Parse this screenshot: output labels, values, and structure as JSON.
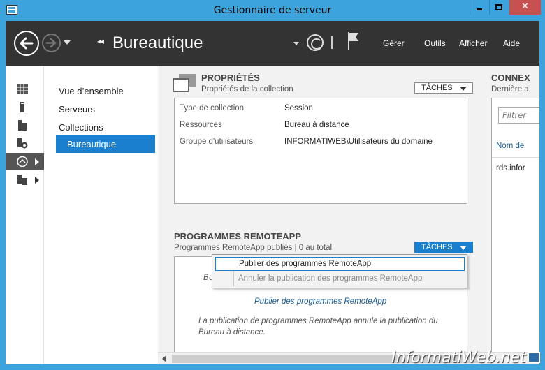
{
  "window": {
    "title": "Gestionnaire de serveur"
  },
  "header": {
    "breadcrumb_arrows": "◂◂",
    "title": "Bureautique",
    "menus": [
      "Gérer",
      "Outils",
      "Afficher",
      "Aide"
    ]
  },
  "iconbar": {
    "items": [
      {
        "name": "dashboard-icon"
      },
      {
        "name": "local-server-icon"
      },
      {
        "name": "all-servers-icon"
      },
      {
        "name": "file-storage-icon"
      },
      {
        "name": "remote-desktop-icon",
        "active": true
      },
      {
        "name": "rds-icon"
      }
    ]
  },
  "nav": {
    "items": [
      "Vue d’ensemble",
      "Serveurs",
      "Collections",
      "Bureautique"
    ],
    "selected": "Bureautique"
  },
  "properties": {
    "title": "PROPRIÉTÉS",
    "subtitle": "Propriétés de la collection",
    "tasks": "TÂCHES",
    "rows": [
      {
        "label": "Type de collection",
        "value": "Session"
      },
      {
        "label": "Ressources",
        "value": "Bureau à distance"
      },
      {
        "label": "Groupe d'utilisateurs",
        "value": "INFORMATIWEB\\Utilisateurs du domaine"
      }
    ]
  },
  "remoteapp": {
    "title": "PROGRAMMES REMOTEAPP",
    "subtitle": "Programmes RemoteApp publiés | 0 au total",
    "tasks": "TÂCHES",
    "partial_text": "Bu",
    "link": "Publier des programmes RemoteApp",
    "description": "La publication de programmes RemoteApp annule la publication du Bureau à distance."
  },
  "tasks_menu": {
    "items": [
      {
        "label": "Publier des programmes RemoteApp",
        "enabled": true
      },
      {
        "label": "Annuler la publication des programmes RemoteApp",
        "enabled": false
      }
    ]
  },
  "connections": {
    "title": "CONNEX",
    "subtitle": "Dernière a",
    "filter_placeholder": "Filtrer",
    "column": "Nom de",
    "row": "rds.infor"
  },
  "watermark": {
    "text": "InformatiWeb.net"
  }
}
